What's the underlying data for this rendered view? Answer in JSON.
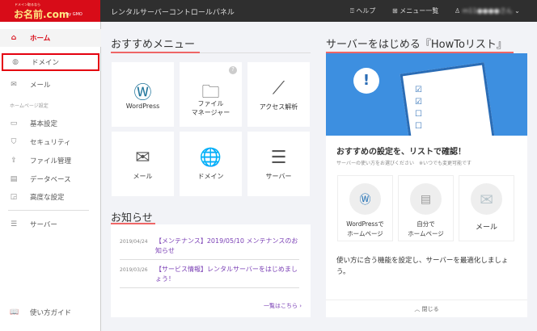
{
  "header": {
    "logo_small": "ドメイン取るなら",
    "logo_main": "お名前.com",
    "logo_sub": "by GMO",
    "title": "レンタルサーバーコントロールパネル",
    "help": "ヘルプ",
    "menu_list": "メニュー一覧",
    "user": "m11●●●●さん"
  },
  "sidebar": {
    "home": "ホーム",
    "domain": "ドメイン",
    "mail": "メール",
    "section": "ホームページ設定",
    "basic": "基本設定",
    "security": "セキュリティ",
    "file": "ファイル管理",
    "db": "データベース",
    "advanced": "高度な設定",
    "server": "サーバー",
    "guide": "使い方ガイド"
  },
  "recommend": {
    "title": "おすすめメニュー",
    "items": [
      {
        "label": "WordPress"
      },
      {
        "label": "ファイル\nマネージャー"
      },
      {
        "label": "アクセス解析"
      },
      {
        "label": "メール"
      },
      {
        "label": "ドメイン"
      },
      {
        "label": "サーバー"
      }
    ]
  },
  "news": {
    "title": "お知らせ",
    "items": [
      {
        "date": "2019/04/24",
        "text": "【メンテナンス】2019/05/10 メンテナンスのお知らせ"
      },
      {
        "date": "2019/03/26",
        "text": "【サービス情報】レンタルサーバーをはじめましょう！"
      }
    ],
    "more": "一覧はこちら ›"
  },
  "howto": {
    "title": "サーバーをはじめる『HowToリスト』",
    "heading": "おすすめの設定を、リストで確認！",
    "sub": "サーバーの使い方をお選びください　※いつでも変更可能です",
    "cards": [
      "WordPressで\nホームページ",
      "自分で\nホームページ",
      "メール"
    ],
    "desc": "使い方に合う機能を設定し、サーバーを最適化しましょう。",
    "close": "閉じる"
  }
}
